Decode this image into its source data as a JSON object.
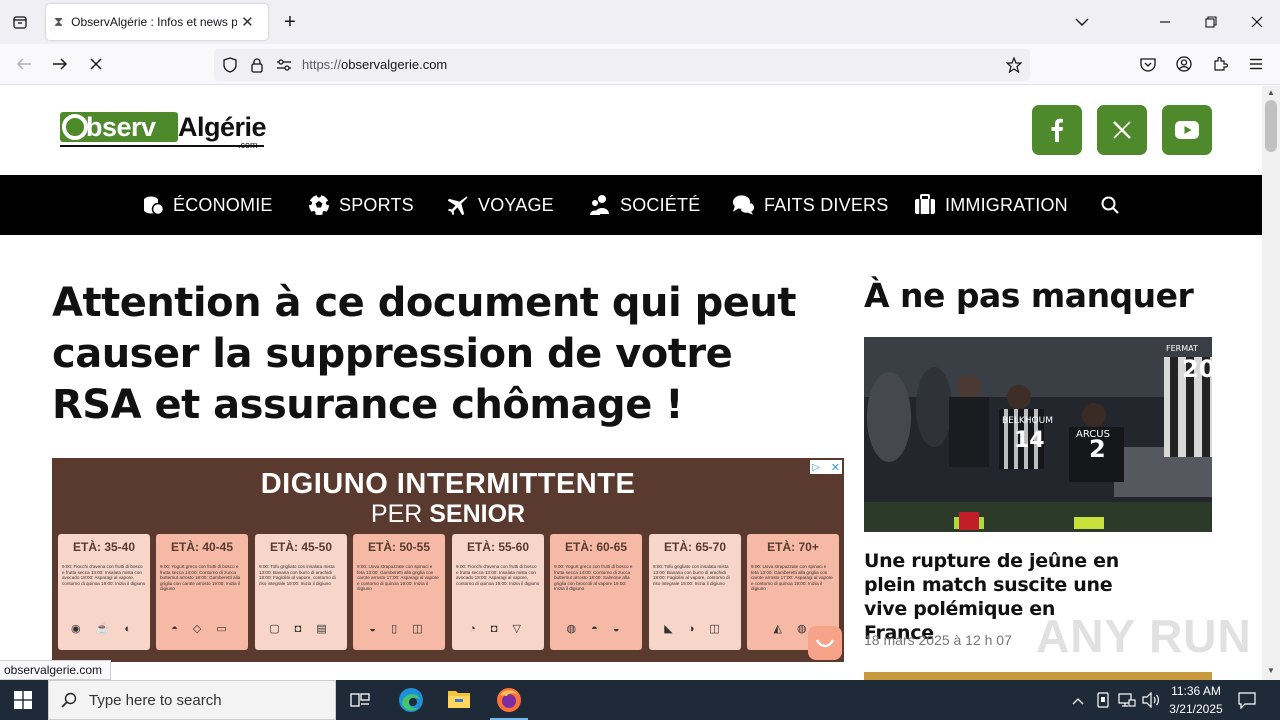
{
  "browser": {
    "tab_title": "ObservAlgérie : Infos et news pratiques",
    "url_protocol": "https://",
    "url_domain": "observalgerie.com",
    "status_url": "observalgerie.com"
  },
  "site": {
    "logo_part1": "bserv",
    "logo_o": "O",
    "logo_part2": "Algérie",
    "logo_suffix": ".com",
    "brand_color": "#4e8a2c",
    "social": [
      "facebook-icon",
      "x-icon",
      "youtube-icon"
    ]
  },
  "menu": {
    "items": [
      {
        "label": "ÉCONOMIE",
        "icon": "coins-icon"
      },
      {
        "label": "SPORTS",
        "icon": "soccer-ball-icon"
      },
      {
        "label": "VOYAGE",
        "icon": "plane-icon"
      },
      {
        "label": "SOCIÉTÉ",
        "icon": "users-icon"
      },
      {
        "label": "FAITS DIVERS",
        "icon": "comments-icon"
      },
      {
        "label": "IMMIGRATION",
        "icon": "suitcase-icon"
      }
    ]
  },
  "article": {
    "headline": "Attention à ce document qui peut causer la suppression de votre RSA et assurance chômage !"
  },
  "ad": {
    "title": "DIGIUNO INTERMITTENTE",
    "subtitle_pre": "PER ",
    "subtitle_bold": "SENIOR",
    "cards": [
      {
        "age": "ETÀ: 35-40",
        "text": "9:00: Fiocchi d'avena con frutti di bosco e frutta secca 13:00: Insalata mista con avocado 18:00: Asparagi al vapore, contorno di quinoa 19:00: Inizia il digiuno",
        "icons": "◉ ☕ ◐"
      },
      {
        "age": "ETÀ: 40-45",
        "text": "9:00: Yogurt greco con frutti di bosco e frutta secca 14:00: Contorno di zucca butternut arrosto 18:00: Gamberetti alla griglia con carote arrosto 19:00: Inizia il digiuno",
        "icons": "◓ ◇ ▭"
      },
      {
        "age": "ETÀ: 45-50",
        "text": "9:00: Tofu grigliato con insalata mista 13:00: Banana con burro di arachidi 18:00: Fagiolini al vapore, contorno di riso integrale 19:00: Inizia il digiuno",
        "icons": "▢ ◘ ▤"
      },
      {
        "age": "ETÀ: 50-55",
        "text": "9:00: Uova strapazzate con spinaci e feta 13:00: Gamberetti alla griglia con carote arrosto 17:00: Asparagi al vapore e contorno di quinoa 19:00: Inizia il digiuno",
        "icons": "◒ ▯ ◫"
      },
      {
        "age": "ETÀ: 55-60",
        "text": "9:00: Fiocchi d'avena con frutti di bosco e frutta secca 13:00: Insalata mista con avocado 18:00: Asparagi al vapore, contorno di quinoa 19:00: Inizia il digiuno",
        "icons": "◔ ◘ ▽"
      },
      {
        "age": "ETÀ: 60-65",
        "text": "9:00: Yogurt greco con frutti di bosco e frutta secca 14:00: Contorno di zucca butternut arrosto 18:00: Salmone alla griglia con broccoli al vapore 19:00: Inizia il digiuno",
        "icons": "◍ ◓ ◒"
      },
      {
        "age": "ETÀ: 65-70",
        "text": "9:00: Tofu grigliato con insalata mista 13:00: Banana con burro di arachidi 18:00: Fagiolini al vapore, contorno di riso integrale 19:00: Inizia il digiuno",
        "icons": "◣ ◑ ◫"
      },
      {
        "age": "ETÀ: 70+",
        "text": "9:00: Uova strapazzate con spinaci e feta 13:00: Gamberetti alla griglia con carote arrosto 17:00: Asparagi al vapore e contorno di quinoa 19:00: Inizia il digiuno",
        "icons": "◭ ◍"
      }
    ]
  },
  "sidebar": {
    "title": "À ne pas manquer",
    "headline": "Une rupture de jeûne en plein match suscite une vive polémique en France",
    "date": "18 mars 2025 à 12 h 07",
    "jersey_numbers": [
      "14",
      "2",
      "20"
    ],
    "jersey_names": [
      "BELKHOUM",
      "ARCUS",
      "FERMAT"
    ]
  },
  "watermark": "ANY RUN",
  "taskbar": {
    "search_placeholder": "Type here to search",
    "time": "11:36 AM",
    "date": "3/21/2025"
  }
}
